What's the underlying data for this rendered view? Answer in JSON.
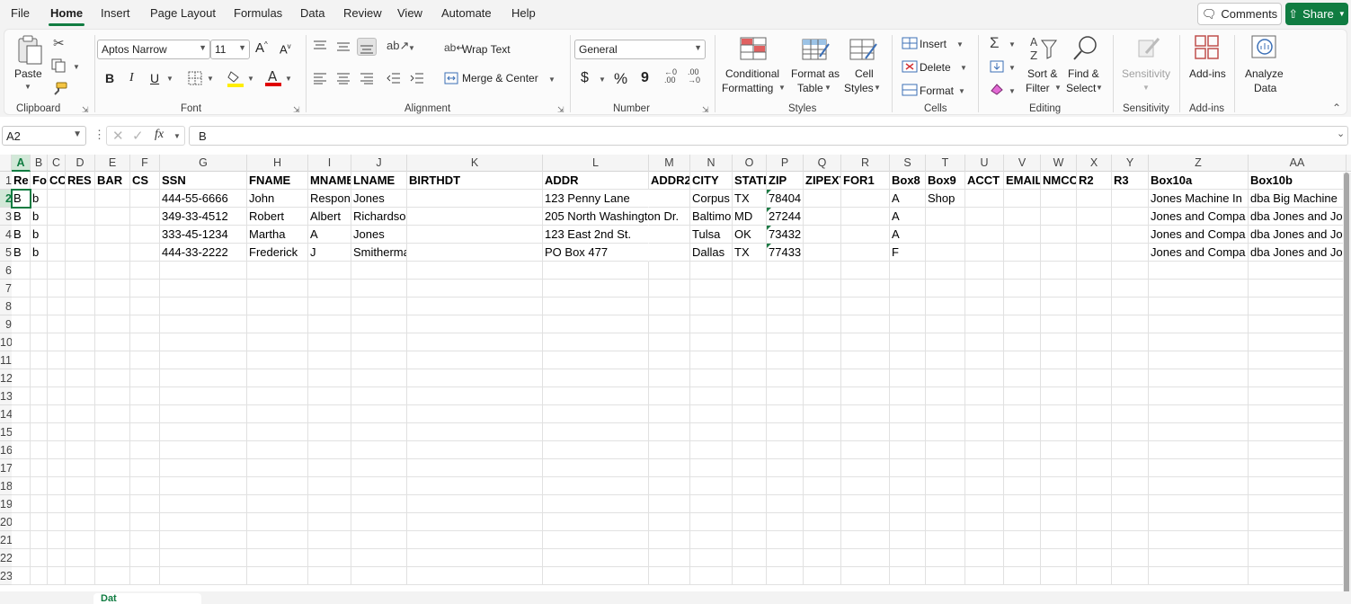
{
  "menu": {
    "tabs": [
      "File",
      "Home",
      "Insert",
      "Page Layout",
      "Formulas",
      "Data",
      "Review",
      "View",
      "Automate",
      "Help"
    ],
    "active": "Home",
    "comments_label": "Comments",
    "share_label": "Share"
  },
  "ribbon": {
    "clipboard": {
      "paste_label": "Paste",
      "group_label": "Clipboard"
    },
    "font": {
      "font_name": "Aptos Narrow",
      "font_size": "11",
      "bold": "B",
      "italic": "I",
      "underline": "U",
      "group_label": "Font"
    },
    "alignment": {
      "wrap_text": "Wrap Text",
      "merge_center": "Merge & Center",
      "group_label": "Alignment"
    },
    "number": {
      "format": "General",
      "currency": "$",
      "percent": "%",
      "comma": "9",
      "group_label": "Number"
    },
    "styles": {
      "conditional_1": "Conditional",
      "conditional_2": "Formatting",
      "format_table_1": "Format as",
      "format_table_2": "Table",
      "cell_styles_1": "Cell",
      "cell_styles_2": "Styles",
      "group_label": "Styles"
    },
    "cells": {
      "insert": "Insert",
      "delete": "Delete",
      "format": "Format",
      "group_label": "Cells"
    },
    "editing": {
      "sort_1": "Sort &",
      "sort_2": "Filter",
      "find_1": "Find &",
      "find_2": "Select",
      "group_label": "Editing"
    },
    "sensitivity": {
      "label": "Sensitivity",
      "group_label": "Sensitivity"
    },
    "addins": {
      "label": "Add-ins",
      "group_label": "Add-ins"
    },
    "analyze": {
      "label_1": "Analyze",
      "label_2": "Data"
    }
  },
  "formula_bar": {
    "name_box": "A2",
    "fx": "fx",
    "value": "B"
  },
  "columns": [
    "A",
    "B",
    "C",
    "D",
    "E",
    "F",
    "G",
    "H",
    "I",
    "J",
    "K",
    "L",
    "M",
    "N",
    "O",
    "P",
    "Q",
    "R",
    "S",
    "T",
    "U",
    "V",
    "W",
    "X",
    "Y",
    "Z",
    "AA"
  ],
  "row_numbers": [
    "1",
    "2",
    "3",
    "4",
    "5",
    "6",
    "7",
    "8",
    "9",
    "10",
    "11",
    "12",
    "13",
    "14",
    "15",
    "16",
    "17",
    "18",
    "19",
    "20",
    "21",
    "22",
    "23"
  ],
  "header_row": [
    "Re",
    "Fo",
    "CC",
    "RES",
    "BAR",
    "CS",
    "SSN",
    "FNAME",
    "MNAME",
    "LNAME",
    "BIRTHDT",
    "ADDR",
    "ADDR2",
    "CITY",
    "STATE",
    "ZIP",
    "ZIPEXT",
    "FOR1",
    "Box8",
    "Box9",
    "ACCT",
    "EMAIL",
    "NMCC",
    "R2",
    "R3",
    "Box10a",
    "Box10b"
  ],
  "data_rows": [
    [
      "B",
      "b",
      "",
      "",
      "",
      "",
      "444-55-6666",
      "John",
      "Respon",
      "Jones",
      "",
      "123 Penny Lane",
      "",
      "Corpus",
      "TX",
      "78404",
      "",
      "",
      "A",
      "Shop",
      "",
      "",
      "",
      "",
      "",
      "Jones Machine In",
      "dba Big Machine"
    ],
    [
      "B",
      "b",
      "",
      "",
      "",
      "",
      "349-33-4512",
      "Robert",
      "Albert",
      "Richardson",
      "",
      "205 North Washington Dr.",
      "",
      "Baltimo",
      "MD",
      "27244",
      "",
      "",
      "A",
      "",
      "",
      "",
      "",
      "",
      "",
      "Jones and Compa",
      "dba Jones and Jo"
    ],
    [
      "B",
      "b",
      "",
      "",
      "",
      "",
      "333-45-1234",
      "Martha",
      "A",
      "Jones",
      "",
      "123 East 2nd St.",
      "",
      "Tulsa",
      "OK",
      "73432",
      "",
      "",
      "A",
      "",
      "",
      "",
      "",
      "",
      "",
      "Jones and Compa",
      "dba Jones and Jo"
    ],
    [
      "B",
      "b",
      "",
      "",
      "",
      "",
      "444-33-2222",
      "Frederick",
      "J",
      "Smitherman",
      "",
      "PO Box 477",
      "",
      "Dallas",
      "TX",
      "77433",
      "",
      "",
      "F",
      "",
      "",
      "",
      "",
      "",
      "",
      "Jones and Compa",
      "dba Jones and Jo"
    ]
  ],
  "sheet_tab": "Dat",
  "colors": {
    "accent": "#107c41",
    "ribbon_bg": "#f3f3f3"
  }
}
